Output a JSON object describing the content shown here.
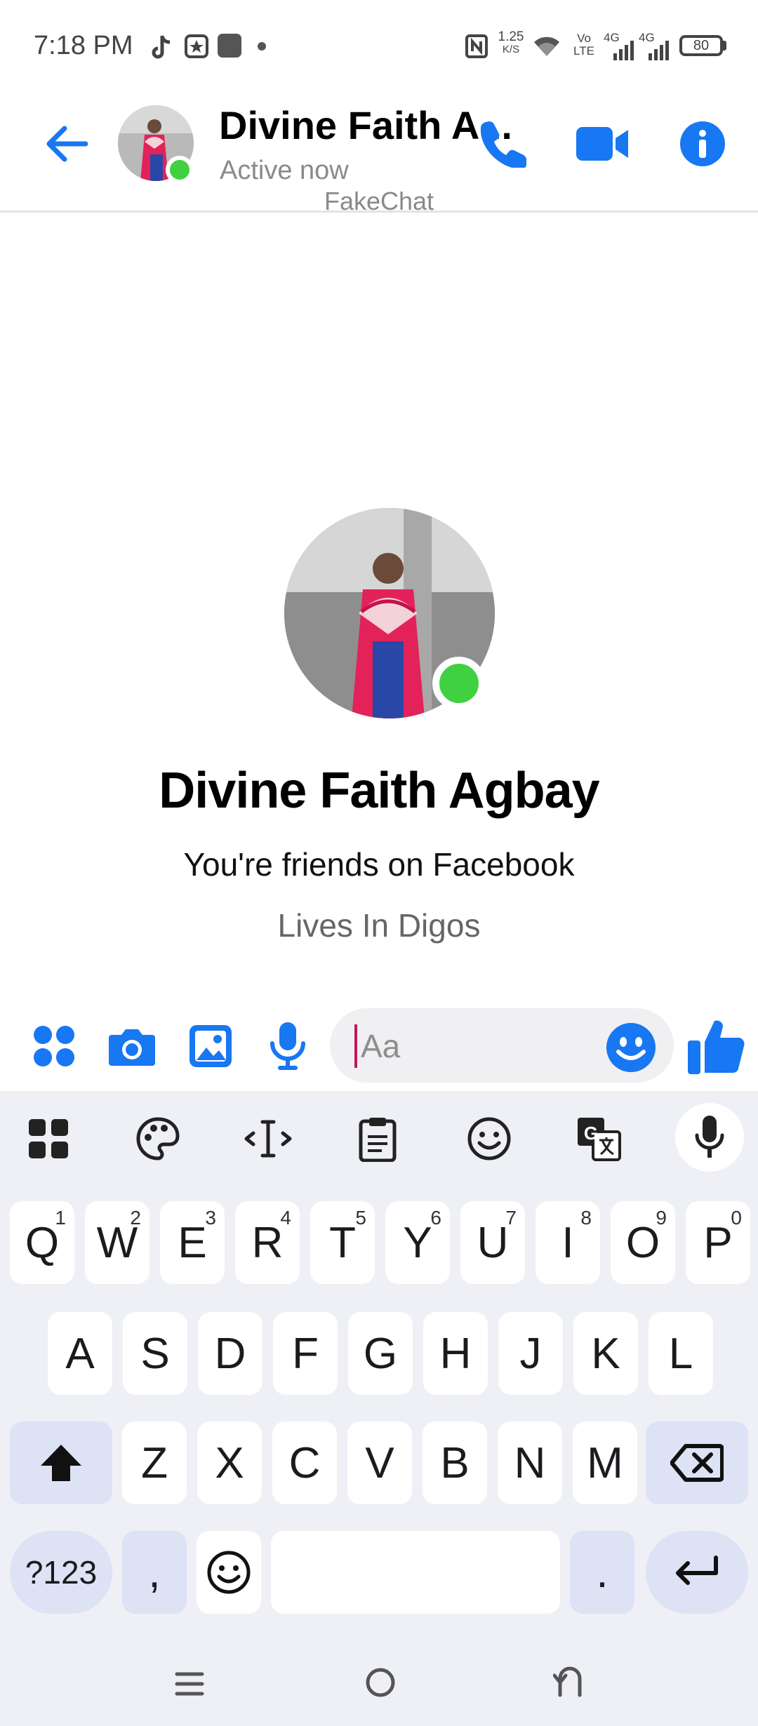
{
  "status_bar": {
    "time": "7:18 PM",
    "net_speed_value": "1.25",
    "net_speed_unit": "K/S",
    "volte": "Vo\nLTE",
    "sim1": "4G",
    "sim2": "4G",
    "battery": "80"
  },
  "header": {
    "contact_name": "Divine Faith A...",
    "status": "Active now",
    "watermark": "FakeChat"
  },
  "profile": {
    "name": "Divine Faith Agbay",
    "friends_text": "You're friends on Facebook",
    "lives_text": "Lives In Digos"
  },
  "composer": {
    "placeholder": "Aa"
  },
  "keyboard": {
    "row1": [
      {
        "label": "Q",
        "hint": "1"
      },
      {
        "label": "W",
        "hint": "2"
      },
      {
        "label": "E",
        "hint": "3"
      },
      {
        "label": "R",
        "hint": "4"
      },
      {
        "label": "T",
        "hint": "5"
      },
      {
        "label": "Y",
        "hint": "6"
      },
      {
        "label": "U",
        "hint": "7"
      },
      {
        "label": "I",
        "hint": "8"
      },
      {
        "label": "O",
        "hint": "9"
      },
      {
        "label": "P",
        "hint": "0"
      }
    ],
    "row2": [
      "A",
      "S",
      "D",
      "F",
      "G",
      "H",
      "J",
      "K",
      "L"
    ],
    "row3": [
      "Z",
      "X",
      "C",
      "V",
      "B",
      "N",
      "M"
    ],
    "symbols_label": "?123",
    "comma_label": ",",
    "period_label": "."
  },
  "colors": {
    "messenger_blue": "#1877f2",
    "online_green": "#3fd13f",
    "keyboard_bg": "#eef0f6",
    "modifier_key": "#dde2f5"
  }
}
